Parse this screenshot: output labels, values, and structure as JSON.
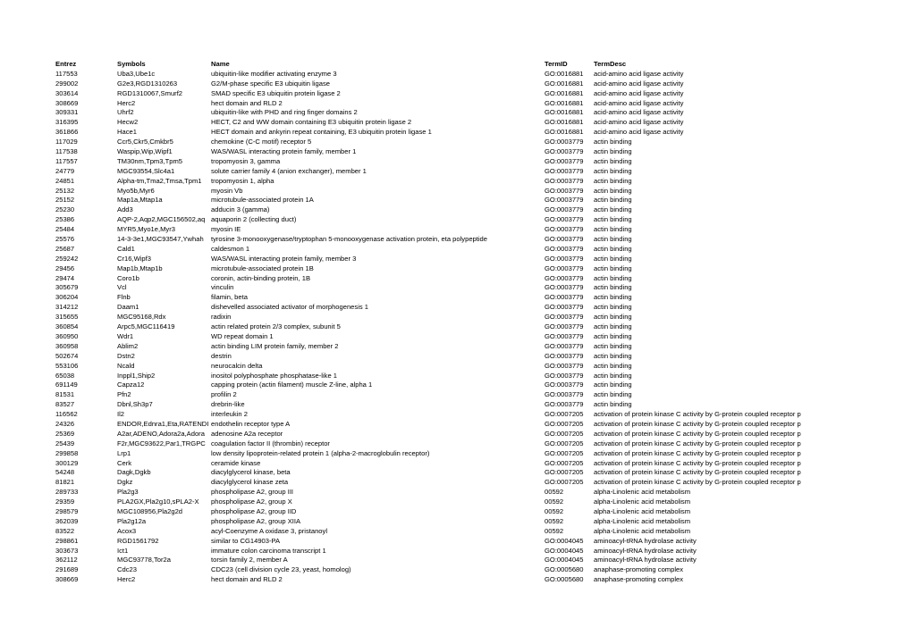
{
  "header": {
    "entrez": "Entrez",
    "symbols": "Symbols",
    "name": "Name",
    "termid": "TermID",
    "termdesc": "TermDesc"
  },
  "rows": [
    [
      "117553",
      "Uba3,Ube1c",
      "ubiquitin-like modifier activating enzyme 3",
      "GO:0016881",
      "acid-amino acid ligase activity"
    ],
    [
      "299002",
      "G2e3,RGD1310263",
      "G2/M-phase specific E3 ubiquitin ligase",
      "GO:0016881",
      "acid-amino acid ligase activity"
    ],
    [
      "303614",
      "RGD1310067,Smurf2",
      "SMAD specific E3 ubiquitin protein ligase 2",
      "GO:0016881",
      "acid-amino acid ligase activity"
    ],
    [
      "308669",
      "Herc2",
      "hect domain and RLD 2",
      "GO:0016881",
      "acid-amino acid ligase activity"
    ],
    [
      "309331",
      "Uhrf2",
      "ubiquitin-like with PHD and ring finger domains 2",
      "GO:0016881",
      "acid-amino acid ligase activity"
    ],
    [
      "316395",
      "Hecw2",
      "HECT, C2 and WW domain containing E3 ubiquitin protein ligase 2",
      "GO:0016881",
      "acid-amino acid ligase activity"
    ],
    [
      "361866",
      "Hace1",
      "HECT domain and ankyrin repeat containing, E3 ubiquitin protein ligase 1",
      "GO:0016881",
      "acid-amino acid ligase activity"
    ],
    [
      "117029",
      "Ccr5,Ckr5,Cmkbr5",
      "chemokine (C-C motif) receptor 5",
      "GO:0003779",
      "actin binding"
    ],
    [
      "117538",
      "Waspip,Wip,Wipf1",
      "WAS/WASL interacting protein family, member 1",
      "GO:0003779",
      "actin binding"
    ],
    [
      "117557",
      "TM30nm,Tpm3,Tpm5",
      "tropomyosin 3, gamma",
      "GO:0003779",
      "actin binding"
    ],
    [
      "24779",
      "MGC93554,Slc4a1",
      "solute carrier family 4 (anion exchanger), member 1",
      "GO:0003779",
      "actin binding"
    ],
    [
      "24851",
      "Alpha-tm,Tma2,Tmsa,Tpm1",
      "tropomyosin 1, alpha",
      "GO:0003779",
      "actin binding"
    ],
    [
      "25132",
      "Myo5b,Myr6",
      "myosin Vb",
      "GO:0003779",
      "actin binding"
    ],
    [
      "25152",
      "Map1a,Mtap1a",
      "microtubule-associated protein 1A",
      "GO:0003779",
      "actin binding"
    ],
    [
      "25230",
      "Add3",
      "adducin 3 (gamma)",
      "GO:0003779",
      "actin binding"
    ],
    [
      "25386",
      "AQP-2,Aqp2,MGC156502,aq",
      "aquaporin 2 (collecting duct)",
      "GO:0003779",
      "actin binding"
    ],
    [
      "25484",
      "MYR5,Myo1e,Myr3",
      "myosin IE",
      "GO:0003779",
      "actin binding"
    ],
    [
      "25576",
      "14-3-3e1,MGC93547,Ywhah",
      "tyrosine 3-monooxygenase/tryptophan 5-monooxygenase activation protein, eta polypeptide",
      "GO:0003779",
      "actin binding"
    ],
    [
      "25687",
      "Cald1",
      "caldesmon 1",
      "GO:0003779",
      "actin binding"
    ],
    [
      "259242",
      "Cr16,Wipf3",
      "WAS/WASL interacting protein family, member 3",
      "GO:0003779",
      "actin binding"
    ],
    [
      "29456",
      "Map1b,Mtap1b",
      "microtubule-associated protein 1B",
      "GO:0003779",
      "actin binding"
    ],
    [
      "29474",
      "Coro1b",
      "coronin, actin-binding protein, 1B",
      "GO:0003779",
      "actin binding"
    ],
    [
      "305679",
      "Vcl",
      "vinculin",
      "GO:0003779",
      "actin binding"
    ],
    [
      "306204",
      "Flnb",
      "filamin, beta",
      "GO:0003779",
      "actin binding"
    ],
    [
      "314212",
      "Daam1",
      "dishevelled associated activator of morphogenesis 1",
      "GO:0003779",
      "actin binding"
    ],
    [
      "315655",
      "MGC95168,Rdx",
      "radixin",
      "GO:0003779",
      "actin binding"
    ],
    [
      "360854",
      "Arpc5,MGC116419",
      "actin related protein 2/3 complex, subunit 5",
      "GO:0003779",
      "actin binding"
    ],
    [
      "360950",
      "Wdr1",
      "WD repeat domain 1",
      "GO:0003779",
      "actin binding"
    ],
    [
      "360958",
      "Ablim2",
      "actin binding LIM protein family, member 2",
      "GO:0003779",
      "actin binding"
    ],
    [
      "502674",
      "Dstn2",
      "destrin",
      "GO:0003779",
      "actin binding"
    ],
    [
      "553106",
      "Ncald",
      "neurocalcin delta",
      "GO:0003779",
      "actin binding"
    ],
    [
      "65038",
      "Inppl1,Ship2",
      "inositol polyphosphate phosphatase-like 1",
      "GO:0003779",
      "actin binding"
    ],
    [
      "691149",
      "Capza12",
      "capping protein (actin filament) muscle Z-line, alpha 1",
      "GO:0003779",
      "actin binding"
    ],
    [
      "81531",
      "Pfn2",
      "profilin 2",
      "GO:0003779",
      "actin binding"
    ],
    [
      "83527",
      "Dbnl,Sh3p7",
      "drebrin-like",
      "GO:0003779",
      "actin binding"
    ],
    [
      "116562",
      "Il2",
      "interleukin 2",
      "GO:0007205",
      "activation of protein kinase C activity by G-protein coupled receptor p"
    ],
    [
      "24326",
      "ENDOR,Ednra1,Eta,RATENDI",
      "endothelin receptor type A",
      "GO:0007205",
      "activation of protein kinase C activity by G-protein coupled receptor p"
    ],
    [
      "25369",
      "A2ar,ADENO,Adora2a,Adora",
      "adenosine A2a receptor",
      "GO:0007205",
      "activation of protein kinase C activity by G-protein coupled receptor p"
    ],
    [
      "25439",
      "F2r,MGC93622,Par1,TRGPC",
      "coagulation factor II (thrombin) receptor",
      "GO:0007205",
      "activation of protein kinase C activity by G-protein coupled receptor p"
    ],
    [
      "299858",
      "Lrp1",
      "low density lipoprotein-related protein 1 (alpha-2-macroglobulin receptor)",
      "GO:0007205",
      "activation of protein kinase C activity by G-protein coupled receptor p"
    ],
    [
      "300129",
      "Cerk",
      "ceramide kinase",
      "GO:0007205",
      "activation of protein kinase C activity by G-protein coupled receptor p"
    ],
    [
      "54248",
      "Dagk,Dgkb",
      "diacylglycerol kinase, beta",
      "GO:0007205",
      "activation of protein kinase C activity by G-protein coupled receptor p"
    ],
    [
      "81821",
      "Dgkz",
      "diacylglycerol kinase zeta",
      "GO:0007205",
      "activation of protein kinase C activity by G-protein coupled receptor p"
    ],
    [
      "289733",
      "Pla2g3",
      "phospholipase A2, group III",
      "00592",
      "alpha-Linolenic acid metabolism"
    ],
    [
      "29359",
      "PLA2GX,Pla2g10,sPLA2-X",
      "phospholipase A2, group X",
      "00592",
      "alpha-Linolenic acid metabolism"
    ],
    [
      "298579",
      "MGC108956,Pla2g2d",
      "phospholipase A2, group IID",
      "00592",
      "alpha-Linolenic acid metabolism"
    ],
    [
      "362039",
      "Pla2g12a",
      "phospholipase A2, group XIIA",
      "00592",
      "alpha-Linolenic acid metabolism"
    ],
    [
      "83522",
      "Acox3",
      "acyl-Coenzyme A oxidase 3, pristanoyl",
      "00592",
      "alpha-Linolenic acid metabolism"
    ],
    [
      "298861",
      "RGD1561792",
      "similar to CG14903-PA",
      "GO:0004045",
      "aminoacyl-tRNA hydrolase activity"
    ],
    [
      "303673",
      "Ict1",
      "immature colon carcinoma transcript 1",
      "GO:0004045",
      "aminoacyl-tRNA hydrolase activity"
    ],
    [
      "362112",
      "MGC93778,Tor2a",
      "torsin family 2, member A",
      "GO:0004045",
      "aminoacyl-tRNA hydrolase activity"
    ],
    [
      "291689",
      "Cdc23",
      "CDC23 (cell division cycle 23, yeast, homolog)",
      "GO:0005680",
      "anaphase-promoting complex"
    ],
    [
      "308669",
      "Herc2",
      "hect domain and RLD 2",
      "GO:0005680",
      "anaphase-promoting complex"
    ]
  ]
}
